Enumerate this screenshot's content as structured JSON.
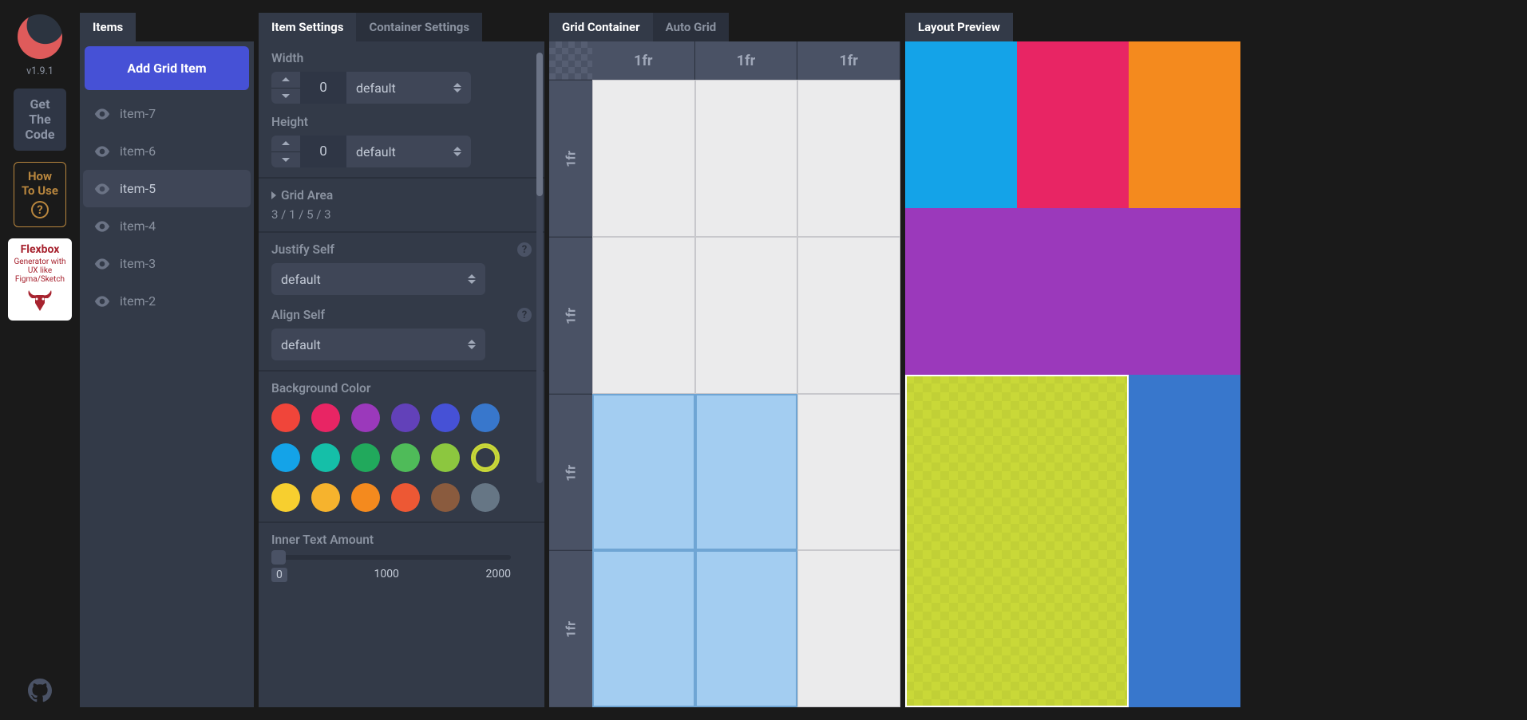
{
  "version": "v1.9.1",
  "rail": {
    "get_code": "Get\nThe\nCode",
    "how_to": "How\nTo Use",
    "flexbox_title": "Flexbox",
    "flexbox_sub": "Generator with UX like Figma/Sketch"
  },
  "items_panel": {
    "tab": "Items",
    "add_button": "Add Grid Item",
    "items": [
      {
        "label": "item-7"
      },
      {
        "label": "item-6"
      },
      {
        "label": "item-5",
        "selected": true
      },
      {
        "label": "item-4"
      },
      {
        "label": "item-3"
      },
      {
        "label": "item-2"
      }
    ]
  },
  "settings_panel": {
    "tabs": {
      "item": "Item Settings",
      "container": "Container Settings"
    },
    "width_label": "Width",
    "width_value": "0",
    "width_unit": "default",
    "height_label": "Height",
    "height_value": "0",
    "height_unit": "default",
    "grid_area_label": "Grid Area",
    "grid_area_value": "3 / 1 / 5 / 3",
    "justify_label": "Justify Self",
    "justify_value": "default",
    "align_label": "Align Self",
    "align_value": "default",
    "bgcolor_label": "Background Color",
    "colors": [
      "#f0453a",
      "#e82564",
      "#9b39bb",
      "#6241b9",
      "#4651d6",
      "#3877cc",
      "#14a3e8",
      "#15bfa8",
      "#21a95c",
      "#4fbb59",
      "#8cc73f",
      "#c9d838",
      "#f7cf2f",
      "#f6b32d",
      "#f48a1e",
      "#ed5834",
      "#8a5b3e",
      "#667685"
    ],
    "selected_color_index": 11,
    "slider_label": "Inner Text Amount",
    "slider": {
      "min": "0",
      "mid": "1000",
      "max": "2000"
    }
  },
  "grid_panel": {
    "tabs": {
      "container": "Grid Container",
      "auto": "Auto Grid"
    },
    "cols": [
      "1fr",
      "1fr",
      "1fr"
    ],
    "rows": [
      "1fr",
      "1fr",
      "1fr",
      "1fr"
    ],
    "selection": {
      "rowStart": 3,
      "colStart": 1,
      "rowEnd": 5,
      "colEnd": 3
    }
  },
  "preview_panel": {
    "tab": "Layout Preview",
    "tiles": [
      {
        "row": "1/2",
        "col": "1/2",
        "color": "#14a3e8"
      },
      {
        "row": "1/2",
        "col": "2/3",
        "color": "#e82564"
      },
      {
        "row": "1/2",
        "col": "3/4",
        "color": "#f48a1e"
      },
      {
        "row": "2/3",
        "col": "1/4",
        "color": "#9b39bb"
      },
      {
        "row": "3/5",
        "col": "1/3",
        "color": "#c9d838",
        "selected": true
      },
      {
        "row": "3/5",
        "col": "3/4",
        "color": "#3877cc"
      }
    ]
  }
}
